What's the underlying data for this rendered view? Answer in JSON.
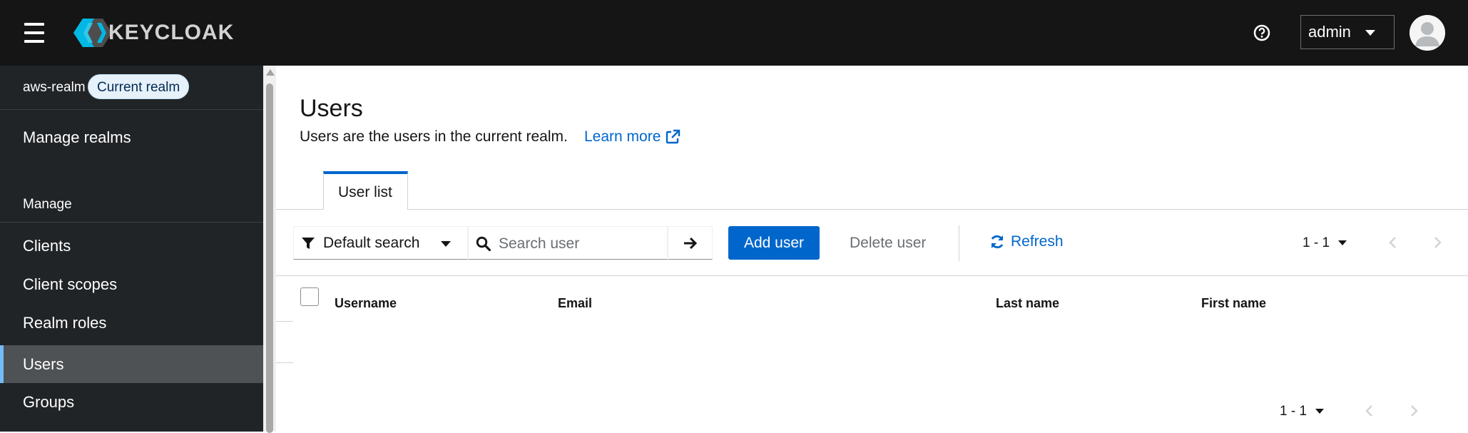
{
  "masthead": {
    "brand": "KEYCLOAK",
    "user": "admin",
    "icons": {
      "menu": "hamburger-icon",
      "help": "question-circle-icon",
      "avatar": "user-avatar-icon"
    }
  },
  "sidebar": {
    "realm": "aws-realm",
    "realm_badge": "Current realm",
    "manage_realms": "Manage realms",
    "section": "Manage",
    "items": [
      {
        "label": "Clients"
      },
      {
        "label": "Client scopes"
      },
      {
        "label": "Realm roles"
      },
      {
        "label": "Users"
      },
      {
        "label": "Groups"
      }
    ],
    "active_item": "Users"
  },
  "main": {
    "title": "Users",
    "description": "Users are the users in the current realm.",
    "learn_more": "Learn more",
    "tabs": [
      {
        "label": "User list"
      }
    ]
  },
  "toolbar": {
    "filter": "Default search",
    "search_placeholder": "Search user",
    "add_user": "Add user",
    "delete_user": "Delete user",
    "refresh": "Refresh",
    "pagination": "1 - 1"
  },
  "table": {
    "columns": [
      "Username",
      "Email",
      "Last name",
      "First name"
    ]
  },
  "footer": {
    "pagination": "1 - 1"
  },
  "colors": {
    "masthead": "#151515",
    "sidebar": "#212427",
    "primary": "#0066cc",
    "active_nav": "#4f5255",
    "active_indicator": "#73bcf7"
  }
}
